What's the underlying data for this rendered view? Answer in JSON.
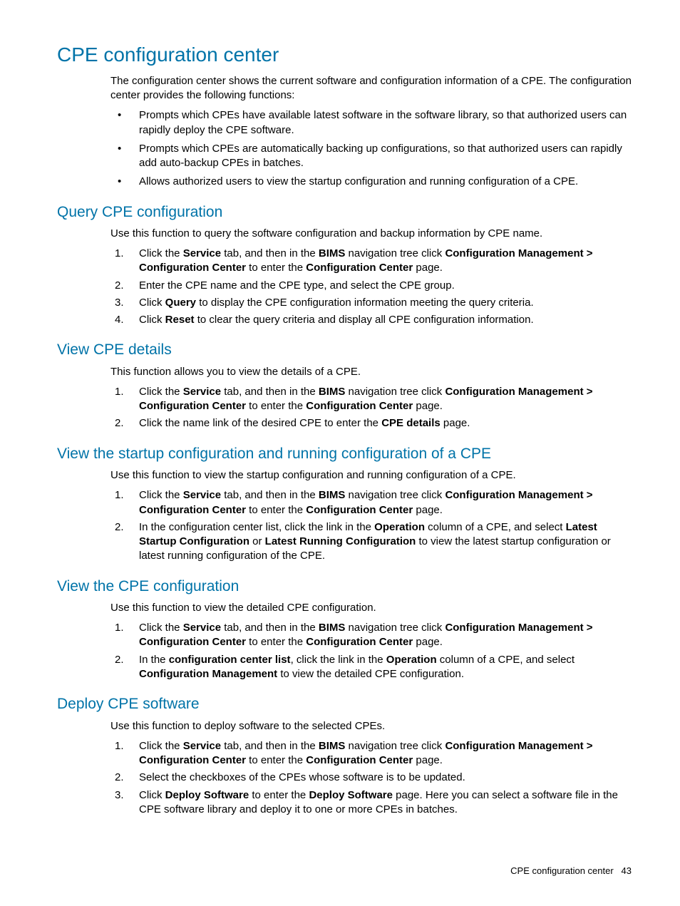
{
  "title": "CPE configuration center",
  "intro": "The configuration center shows the current software and configuration information of a CPE. The configuration center provides the following functions:",
  "bullets": [
    "Prompts which CPEs have available latest software in the software library, so that authorized users can rapidly deploy the CPE software.",
    "Prompts which CPEs are automatically backing up configurations, so that authorized users can rapidly add auto-backup CPEs in batches.",
    "Allows authorized users to view the startup configuration and running configuration of a CPE."
  ],
  "sections": {
    "query": {
      "title": "Query CPE configuration",
      "intro": "Use this function to query the software configuration and backup information by CPE name.",
      "step1a": "Click the ",
      "step1b": "Service",
      "step1c": " tab, and then in the ",
      "step1d": "BIMS",
      "step1e": " navigation tree click ",
      "step1f": "Configuration Management > Configuration Center",
      "step1g": " to enter the ",
      "step1h": "Configuration Center",
      "step1i": " page.",
      "step2": "Enter the CPE name and the CPE type, and select the CPE group.",
      "step3a": "Click ",
      "step3b": "Query",
      "step3c": " to display the CPE configuration information meeting the query criteria.",
      "step4a": "Click ",
      "step4b": "Reset",
      "step4c": " to clear the query criteria and display all CPE configuration information."
    },
    "details": {
      "title": "View CPE details",
      "intro": "This function allows you to view the details of a CPE.",
      "step2a": "Click the name link of the desired CPE to enter the ",
      "step2b": "CPE details",
      "step2c": " page."
    },
    "startup": {
      "title": "View the startup configuration and running configuration of a CPE",
      "intro": "Use this function to view the startup configuration and running configuration of a CPE.",
      "step2a": "In the configuration center list, click the link in the ",
      "step2b": "Operation",
      "step2c": " column of a CPE, and select ",
      "step2d": "Latest Startup Configuration",
      "step2e": " or ",
      "step2f": "Latest Running Configuration",
      "step2g": " to view the latest startup configuration or latest running configuration of the CPE."
    },
    "viewcfg": {
      "title": "View the CPE configuration",
      "intro": "Use this function to view the detailed CPE configuration.",
      "step2a": "In the ",
      "step2b": "configuration center list",
      "step2c": ", click the link in the ",
      "step2d": "Operation",
      "step2e": " column of a CPE, and select ",
      "step2f": "Configuration Management",
      "step2g": " to view the detailed CPE configuration."
    },
    "deploy": {
      "title": "Deploy CPE software",
      "intro": "Use this function to deploy software to the selected CPEs.",
      "step2": "Select the checkboxes of the CPEs whose software is to be updated.",
      "step3a": "Click ",
      "step3b": "Deploy Software",
      "step3c": " to enter the ",
      "step3d": "Deploy Software",
      "step3e": " page. Here you can select a software file in the CPE software library and deploy it to one or more CPEs in batches."
    }
  },
  "footer": {
    "title": "CPE configuration center",
    "pagenum": "43"
  }
}
